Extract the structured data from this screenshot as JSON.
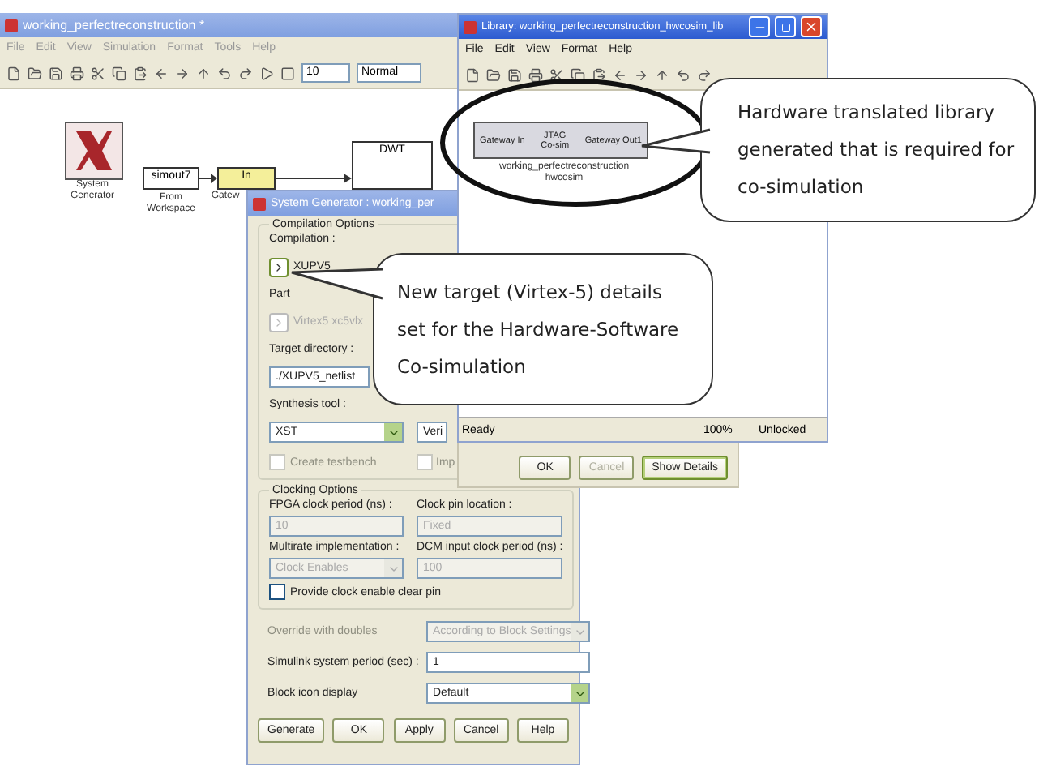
{
  "model_window": {
    "title": "working_perfectreconstruction *",
    "menu": [
      "File",
      "Edit",
      "View",
      "Simulation",
      "Format",
      "Tools",
      "Help"
    ],
    "stop_time": "10",
    "sim_mode": "Normal",
    "blocks": [
      {
        "kind": "sysgen",
        "caption": "System Generator"
      },
      {
        "kind": "source",
        "text": "simout7",
        "caption": "From Workspace"
      },
      {
        "kind": "gateway",
        "text": "In",
        "caption": "Gatew"
      },
      {
        "kind": "subsystem",
        "text": "DWT"
      }
    ]
  },
  "library_window": {
    "title": "Library: working_perfectreconstruction_hwcosim_lib",
    "menu": [
      "File",
      "Edit",
      "View",
      "Format",
      "Help"
    ],
    "block": {
      "input": "Gateway In",
      "center": "JTAG Co-sim",
      "output": "Gateway Out1",
      "caption": "working_perfectreconstruction hwcosim"
    },
    "status": [
      "Ready",
      "100%",
      "Unlocked"
    ]
  },
  "progress_dialog": {
    "buttons": [
      {
        "label": "OK",
        "disabled": false,
        "default": false
      },
      {
        "label": "Cancel",
        "disabled": true,
        "default": false
      },
      {
        "label": "Show Details",
        "disabled": false,
        "default": true
      }
    ]
  },
  "sysgen_dialog": {
    "title": "System Generator : working_per",
    "groups": [
      {
        "title": "Compilation Options",
        "rows": [
          {
            "cells": [
              {
                "kind": "label",
                "text": "Compilation :",
                "disabled": false
              }
            ]
          },
          {
            "cells": [
              {
                "kind": "picker",
                "text": "XUPV5",
                "disabled": false
              }
            ]
          },
          {
            "cells": [
              {
                "kind": "label",
                "text": "Part",
                "disabled": false
              }
            ]
          },
          {
            "cells": [
              {
                "kind": "picker",
                "text": "Virtex5 xc5vlx",
                "disabled": true
              }
            ]
          },
          {
            "cells": [
              {
                "kind": "label",
                "text": "Target directory :",
                "disabled": false
              }
            ]
          },
          {
            "cells": [
              {
                "kind": "field",
                "text": "./XUPV5_netlist",
                "disabled": false
              }
            ]
          },
          {
            "cells": [
              {
                "kind": "label",
                "text": "Synthesis tool :",
                "disabled": false
              }
            ]
          },
          {
            "cells": [
              {
                "kind": "dropdown",
                "text": "XST",
                "disabled": false
              },
              {
                "kind": "dropdown",
                "text": "Veri",
                "disabled": false
              }
            ]
          },
          {
            "cells": [
              {
                "kind": "checkbox",
                "text": "Create testbench",
                "disabled": true,
                "checked": false
              },
              {
                "kind": "checkbox",
                "text": "Imp",
                "disabled": true,
                "checked": false
              }
            ]
          }
        ]
      },
      {
        "title": "Clocking Options",
        "rows": [
          {
            "cells": [
              {
                "kind": "label",
                "text": "FPGA clock period (ns) :",
                "disabled": false
              },
              {
                "kind": "label",
                "text": "Clock pin location :",
                "disabled": false
              }
            ]
          },
          {
            "cells": [
              {
                "kind": "field",
                "text": "10",
                "disabled": true
              },
              {
                "kind": "field",
                "text": "Fixed",
                "disabled": true
              }
            ]
          },
          {
            "cells": [
              {
                "kind": "label",
                "text": "Multirate implementation :",
                "disabled": false
              },
              {
                "kind": "label",
                "text": "DCM input clock period (ns) :",
                "disabled": false
              }
            ]
          },
          {
            "cells": [
              {
                "kind": "dropdown",
                "text": "Clock Enables",
                "disabled": true
              },
              {
                "kind": "field",
                "text": "100",
                "disabled": true
              }
            ]
          },
          {
            "cells": [
              {
                "kind": "checkbox",
                "text": "Provide clock enable clear pin",
                "disabled": false,
                "checked": false
              }
            ]
          }
        ]
      }
    ],
    "rows": [
      {
        "cells": [
          {
            "kind": "label",
            "text": "Override with doubles",
            "disabled": true
          },
          {
            "kind": "dropdown",
            "text": "According to Block Settings",
            "disabled": true
          }
        ]
      },
      {
        "cells": [
          {
            "kind": "label",
            "text": "Simulink system period (sec) :",
            "disabled": false
          },
          {
            "kind": "field",
            "text": "1",
            "disabled": false
          }
        ]
      },
      {
        "cells": [
          {
            "kind": "label",
            "text": "Block icon display",
            "disabled": false
          },
          {
            "kind": "dropdown",
            "text": "Default",
            "disabled": false
          }
        ]
      }
    ],
    "buttons": [
      "Generate",
      "OK",
      "Apply",
      "Cancel",
      "Help"
    ]
  },
  "callouts": [
    {
      "text": "Hardware translated library generated that is required for co-simulation"
    },
    {
      "text": "New target (Virtex-5) details set for the Hardware-Software Co-simulation"
    }
  ]
}
